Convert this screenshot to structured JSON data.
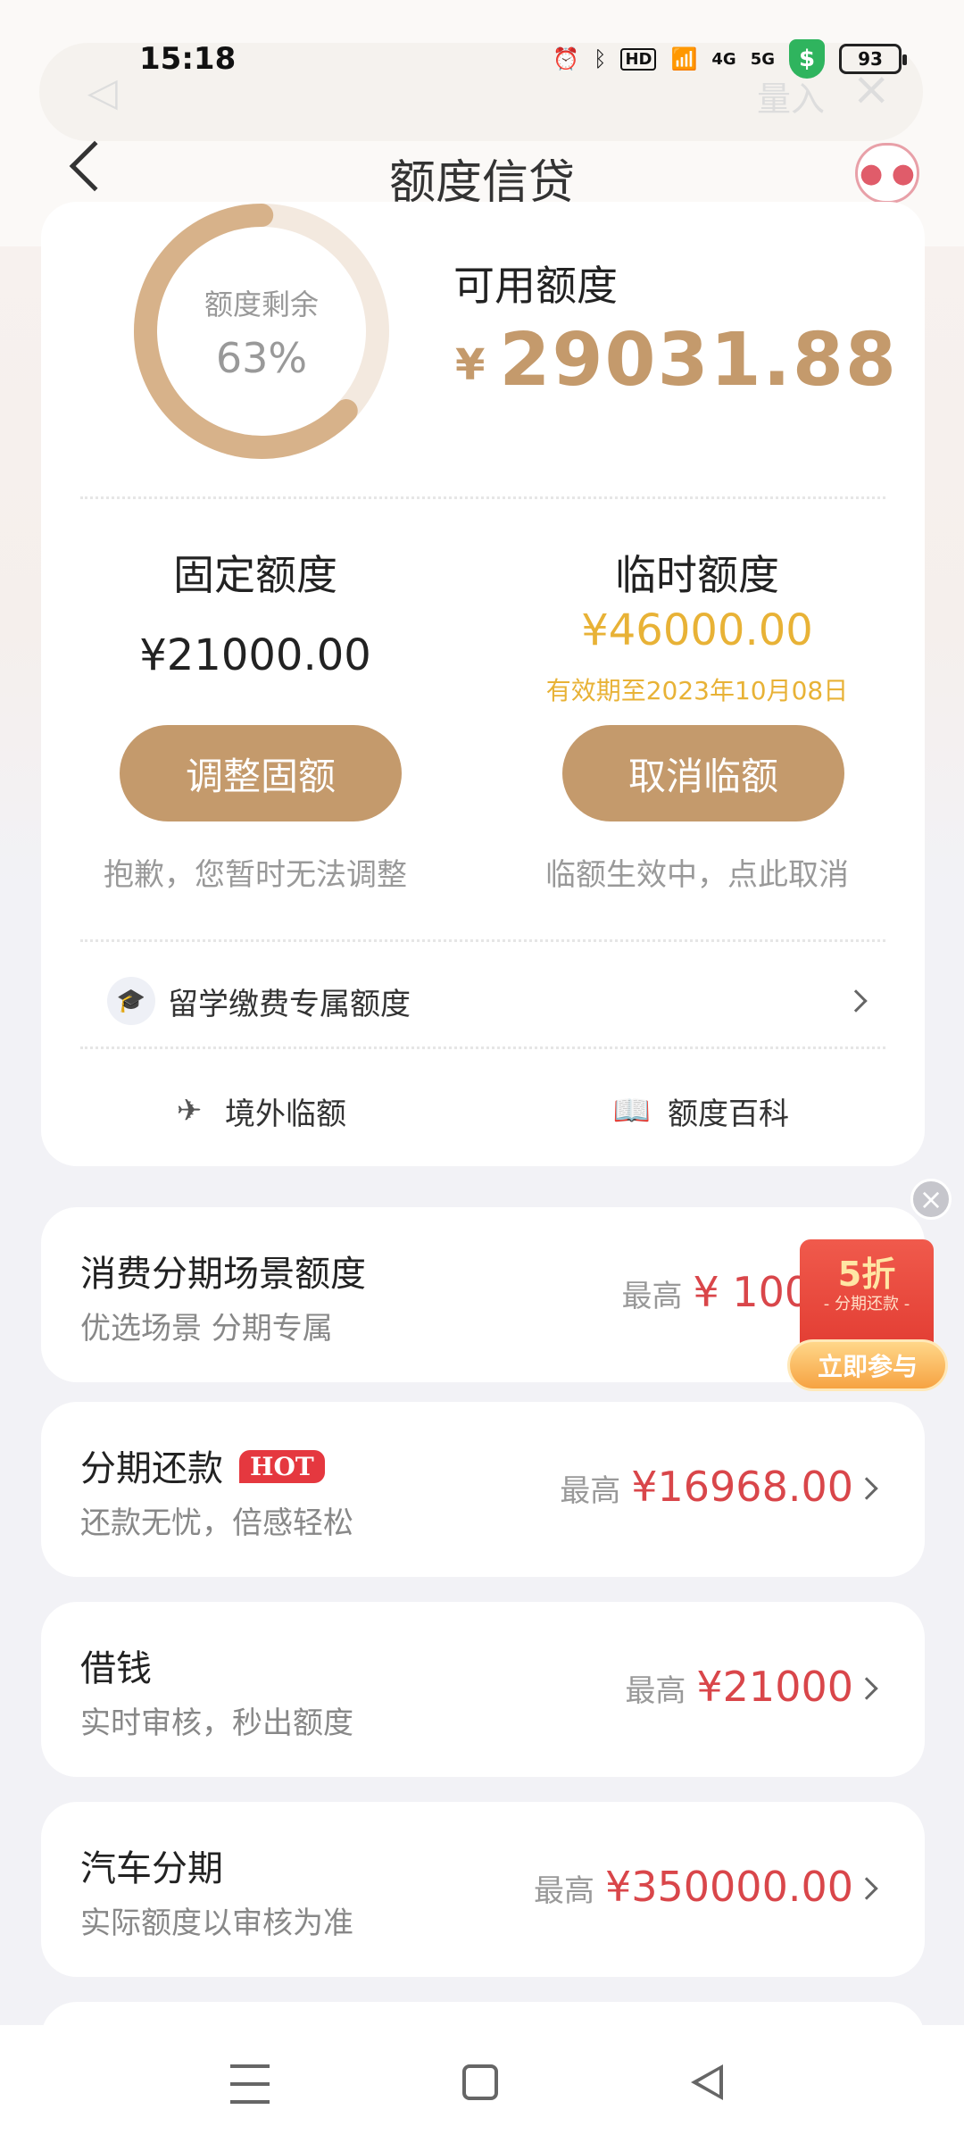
{
  "status_bar": {
    "time": "15:18",
    "icons": [
      "alarm-icon",
      "bluetooth-icon",
      "hd-icon",
      "wifi-icon",
      "4g-signal-icon",
      "5g-signal-icon",
      "shield-icon"
    ],
    "hd_label": "HD",
    "net1": "4G",
    "net2": "5G",
    "shield": "$",
    "battery": "93"
  },
  "ghost_bar": {
    "text": "量入"
  },
  "header": {
    "title": "额度信贷"
  },
  "ring": {
    "label": "额度剩余",
    "percent_text": "63%",
    "percent_value": 0.63
  },
  "available": {
    "label": "可用额度",
    "currency": "¥",
    "amount": "29031.88"
  },
  "fixed": {
    "label": "固定额度",
    "amount": "¥21000.00",
    "button": "调整固额",
    "note": "抱歉，您暂时无法调整"
  },
  "temporary": {
    "label": "临时额度",
    "amount": "¥46000.00",
    "valid": "有效期至2023年10月08日",
    "button": "取消临额",
    "note": "临额生效中，点此取消"
  },
  "study": {
    "label": "留学缴费专属额度"
  },
  "links": {
    "overseas": "境外临额",
    "wiki": "额度百科"
  },
  "products": [
    {
      "title": "消费分期场景额度",
      "sub": "优选场景 分期专属",
      "pre": "最高",
      "amount": "¥ 100000"
    },
    {
      "title": "分期还款",
      "hot": "HOT",
      "sub": "还款无忧，倍感轻松",
      "pre": "最高",
      "amount": "¥16968.00"
    },
    {
      "title": "借钱",
      "sub": "实时审核，秒出额度",
      "pre": "最高",
      "amount": "¥21000"
    },
    {
      "title": "汽车分期",
      "sub": "实际额度以审核为准",
      "pre": "最高",
      "amount": "¥350000.00"
    }
  ],
  "promo": {
    "discount": "5折",
    "sub": "- 分期还款 -",
    "button": "立即参与"
  },
  "colors": {
    "accent": "#c49a6c",
    "temp_yellow": "#e8b236",
    "amount_red": "#d9464a"
  }
}
